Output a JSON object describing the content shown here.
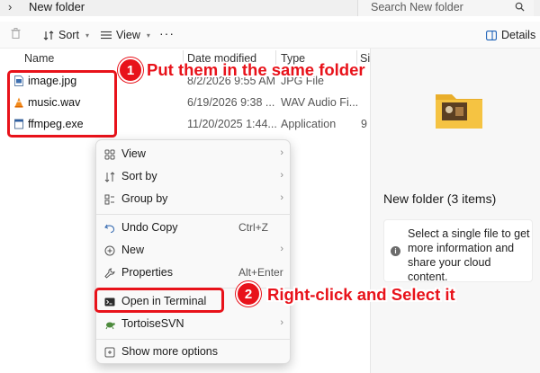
{
  "address": {
    "chevron": "›",
    "crumb": "New folder"
  },
  "search": {
    "placeholder": "Search New folder"
  },
  "toolbar": {
    "sort": "Sort",
    "view": "View",
    "more": "···",
    "details": "Details"
  },
  "columns": {
    "name": "Name",
    "date": "Date modified",
    "type": "Type",
    "size": "Si"
  },
  "files": [
    {
      "name": "image.jpg",
      "date": "8/2/2026 9:55 AM",
      "type": "JPG File",
      "size": "",
      "icon": "image-file-icon"
    },
    {
      "name": "music.wav",
      "date": "6/19/2026 9:38 ...",
      "type": "WAV Audio Fi...",
      "size": "",
      "icon": "vlc-cone-icon"
    },
    {
      "name": "ffmpeg.exe",
      "date": "11/20/2025 1:44...",
      "type": "Application",
      "size": "9",
      "icon": "exe-file-icon"
    }
  ],
  "annotations": {
    "step1_num": "1",
    "step1_text": "Put them in the same folder",
    "step2_num": "2",
    "step2_text": "Right-click and Select it"
  },
  "details_pane": {
    "title": "New folder (3 items)",
    "message": "Select a single file to get more information and share your cloud content."
  },
  "context_menu": {
    "view": "View",
    "sort_by": "Sort by",
    "group_by": "Group by",
    "undo_copy": "Undo Copy",
    "undo_copy_key": "Ctrl+Z",
    "new": "New",
    "properties": "Properties",
    "properties_key": "Alt+Enter",
    "open_terminal": "Open in Terminal",
    "tortoise": "TortoiseSVN",
    "more_options": "Show more options"
  },
  "colors": {
    "accent_red": "#e8121a",
    "folder_yellow": "#f5c342"
  }
}
